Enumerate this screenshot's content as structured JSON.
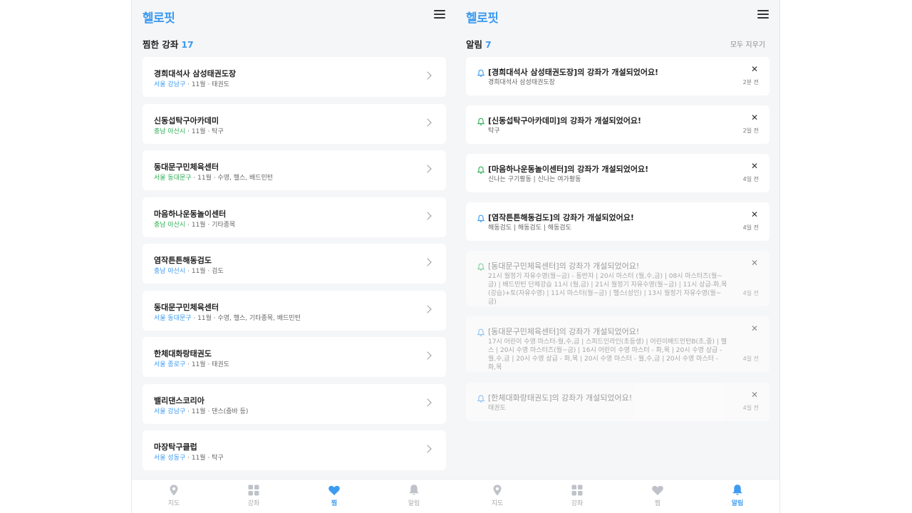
{
  "app": {
    "logo": "헬로핏"
  },
  "colors": {
    "accent": "#3d9bf0",
    "green": "#2fae55",
    "inactive": "#bfc3c9"
  },
  "favorites": {
    "title": "찜한 강좌",
    "count": "17",
    "items": [
      {
        "name": "경희대석사 삼성태권도장",
        "region": "서울 강남구",
        "region_color": "blue",
        "rest": " · 11월 · 태권도"
      },
      {
        "name": "신동섭탁구아카데미",
        "region": "충남 아산시",
        "region_color": "green",
        "rest": " · 11월 · 탁구"
      },
      {
        "name": "동대문구민체육센터",
        "region": "서울 동대문구",
        "region_color": "green",
        "rest": " · 11월 · 수영,  헬스,  배드민턴"
      },
      {
        "name": "마음하나운동놀이센터",
        "region": "충남 아산시",
        "region_color": "green",
        "rest": " · 11월 · 기타종목"
      },
      {
        "name": "염작튼튼해동검도",
        "region": "충남 아산시",
        "region_color": "blue",
        "rest": " · 11월 · 검도"
      },
      {
        "name": "동대문구민체육센터",
        "region": "서울 동대문구",
        "region_color": "blue",
        "rest": " · 11월 · 수영,  헬스,  기타종목,  배드민턴"
      },
      {
        "name": "한체대화랑태권도",
        "region": "서울 종로구",
        "region_color": "blue",
        "rest": " · 11월 · 태권도"
      },
      {
        "name": "밸리댄스코리아",
        "region": "서울 강남구",
        "region_color": "blue",
        "rest": " · 11월 · 댄스(줌바 등)"
      },
      {
        "name": "마장탁구클럽",
        "region": "서울 성동구",
        "region_color": "blue",
        "rest": " · 11월 · 탁구"
      }
    ]
  },
  "notifications": {
    "title": "알림",
    "count": "7",
    "clear_all": "모두 지우기",
    "items": [
      {
        "title": "[경희대석사 삼성태권도장]의 강좌가 개설되었어요!",
        "sub": "경희대석사 삼성태권도장",
        "time": "2분 전",
        "read": false,
        "bell": "blue"
      },
      {
        "title": "[신동섭탁구아카데미]의 강좌가 개설되었어요!",
        "sub": "탁구",
        "time": "2일 전",
        "read": false,
        "bell": "green"
      },
      {
        "title": "[마음하나운동놀이센터]의 강좌가 개설되었어요!",
        "sub": "신나는 구기활동 | 신나는 여가활동",
        "time": "4일 전",
        "read": false,
        "bell": "green"
      },
      {
        "title": "[염작튼튼해동검도]의 강좌가 개설되었어요!",
        "sub": "해동검도 | 해동검도 | 해동검도",
        "time": "4일 전",
        "read": false,
        "bell": "blue"
      },
      {
        "title": "[동대문구민체육센터]의 강좌가 개설되었어요!",
        "sub": "21시 월정기 자유수영(월~금) - 동반자 | 20시 마스터 (월,수,금) | 08시 마스터즈(월~금) | 배드민턴 단체강습 11시 (월,금) | 21시 월정기 자유수영(월~금) | 11시 상급-화,목(강습)+토(자유수영) | 11시 마스터(월~금) | 헬스(성인) | 13시 월정기 자유수영(월~금)",
        "time": "4일 전",
        "read": true,
        "bell": "green"
      },
      {
        "title": "[동대문구민체육센터]의 강좌가 개설되었어요!",
        "sub": "17시 어린이 수영 마스터-월,수,금 | 스피드인라인(초등생) | 어린이배드민턴B(초,중) | 헬스 | 20시 수영 마스터즈(월~금) | 16시 어린이 수영 마스터 - 화,목 | 20시 수영 상급 - 월,수,금 | 20시 수영 상급 - 화,목 | 20시 수영 마스터 - 월,수,금 | 20시 수영 마스터 - 화,목",
        "time": "4일 전",
        "read": true,
        "bell": "blue"
      },
      {
        "title": "[한체대화랑태권도]의 강좌가 개설되었어요!",
        "sub": "태권도",
        "time": "4일 전",
        "read": true,
        "bell": "blue"
      }
    ]
  },
  "tabbar": {
    "left": [
      {
        "label": "지도",
        "icon": "map-pin-icon",
        "active": false
      },
      {
        "label": "강좌",
        "icon": "grid-icon",
        "active": false
      },
      {
        "label": "찜",
        "icon": "heart-icon",
        "active": true
      },
      {
        "label": "알림",
        "icon": "bell-icon",
        "active": false
      }
    ],
    "right": [
      {
        "label": "지도",
        "icon": "map-pin-icon",
        "active": false
      },
      {
        "label": "강좌",
        "icon": "grid-icon",
        "active": false
      },
      {
        "label": "찜",
        "icon": "heart-icon",
        "active": false
      },
      {
        "label": "알림",
        "icon": "bell-icon",
        "active": true
      }
    ]
  }
}
